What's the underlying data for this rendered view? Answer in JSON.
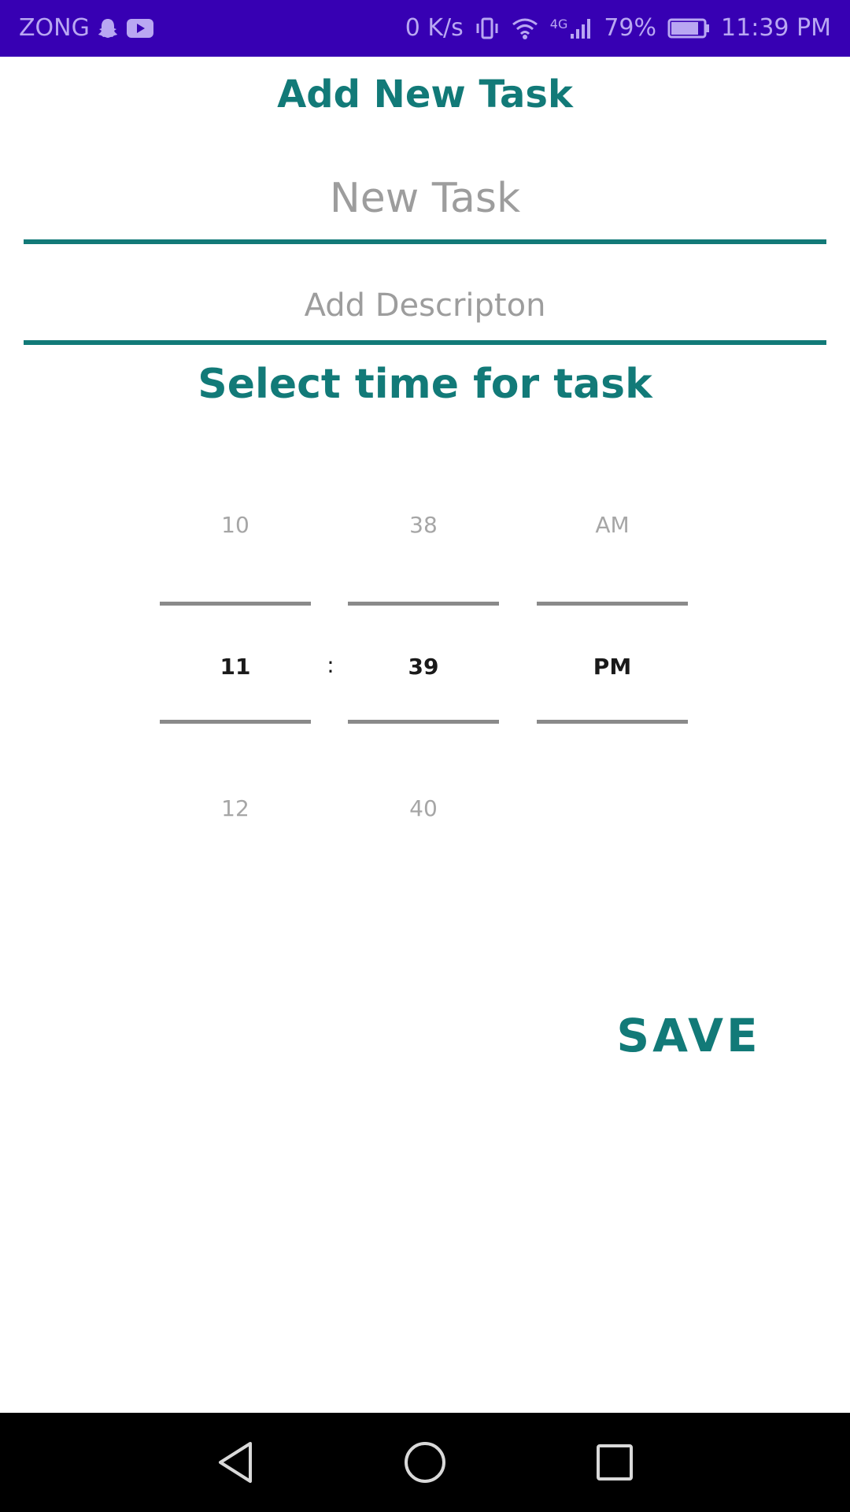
{
  "status_bar": {
    "carrier": "ZONG",
    "network_speed": "0 K/s",
    "network_type": "4G",
    "battery": "79%",
    "time": "11:39 PM",
    "icons": [
      "snapchat-icon",
      "youtube-icon",
      "vibrate-icon",
      "wifi-icon",
      "signal-icon",
      "battery-icon"
    ]
  },
  "header": {
    "title": "Add New Task"
  },
  "form": {
    "task_placeholder": "New Task",
    "description_placeholder": "Add Descripton",
    "time_section_title": "Select time for task"
  },
  "time_picker": {
    "hour": {
      "prev": "10",
      "current": "11",
      "next": "12"
    },
    "separator": ":",
    "minute": {
      "prev": "38",
      "current": "39",
      "next": "40"
    },
    "period": {
      "prev": "AM",
      "current": "PM",
      "next": ""
    }
  },
  "actions": {
    "save_label": "SAVE"
  },
  "nav_bar": {
    "icons": [
      "back-icon",
      "home-icon",
      "recents-icon"
    ]
  },
  "colors": {
    "status_bar": "#3700b3",
    "accent": "#127a78",
    "nav_bar": "#000000"
  }
}
